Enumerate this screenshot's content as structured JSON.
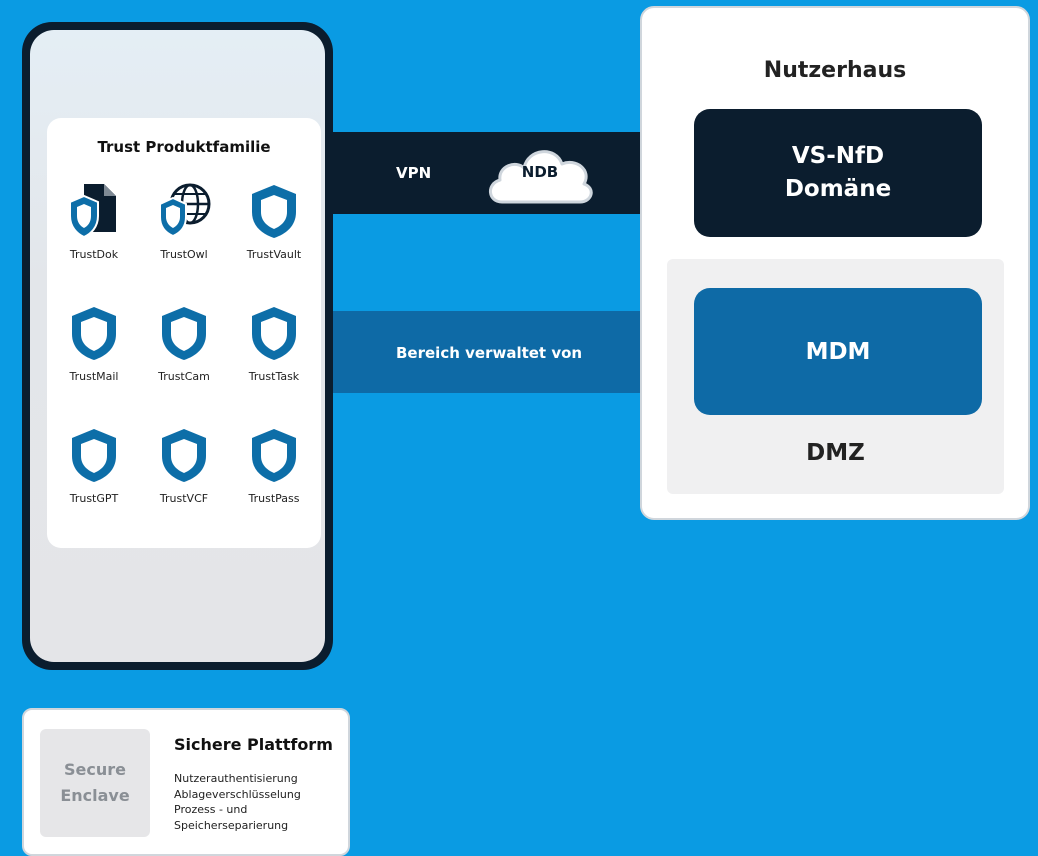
{
  "connections": {
    "vpn_label": "VPN",
    "cloud_label": "NDB",
    "managed_label": "Bereich verwaltet von"
  },
  "phone": {
    "card_title": "Trust Produktfamilie",
    "apps": [
      {
        "label": "TrustDok",
        "icon": "shield-document-icon"
      },
      {
        "label": "TrustOwl",
        "icon": "shield-globe-icon"
      },
      {
        "label": "TrustVault",
        "icon": "shield-icon"
      },
      {
        "label": "TrustMail",
        "icon": "shield-icon"
      },
      {
        "label": "TrustCam",
        "icon": "shield-icon"
      },
      {
        "label": "TrustTask",
        "icon": "shield-icon"
      },
      {
        "label": "TrustGPT",
        "icon": "shield-icon"
      },
      {
        "label": "TrustVCF",
        "icon": "shield-icon"
      },
      {
        "label": "TrustPass",
        "icon": "shield-icon"
      }
    ]
  },
  "house": {
    "title": "Nutzerhaus",
    "vs_line1": "VS-NfD",
    "vs_line2": "Domäne",
    "mdm": "MDM",
    "dmz": "DMZ"
  },
  "platform": {
    "enclave_line1": "Secure",
    "enclave_line2": "Enclave",
    "title": "Sichere Plattform",
    "features": [
      "Nutzerauthentisierung",
      "Ablageverschlüsselung",
      "Prozess - und",
      "Speicherseparierung"
    ]
  },
  "colors": {
    "background": "#0a9be3",
    "navy": "#0b1d2e",
    "mdm_blue": "#0e6aa6",
    "shield_blue": "#0d6ea8"
  }
}
